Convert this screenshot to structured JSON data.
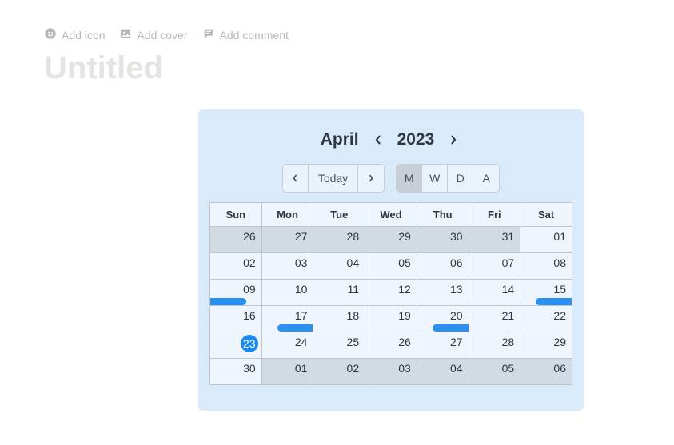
{
  "page": {
    "actions": {
      "add_icon": "Add icon",
      "add_cover": "Add cover",
      "add_comment": "Add comment"
    },
    "title": "Untitled"
  },
  "calendar": {
    "month": "April",
    "year": "2023",
    "today_label": "Today",
    "views": {
      "month": "M",
      "week": "W",
      "day": "D",
      "agenda": "A"
    },
    "active_view": "M",
    "day_headers": [
      "Sun",
      "Mon",
      "Tue",
      "Wed",
      "Thu",
      "Fri",
      "Sat"
    ],
    "weeks": [
      [
        {
          "num": "26",
          "other": true
        },
        {
          "num": "27",
          "other": true
        },
        {
          "num": "28",
          "other": true
        },
        {
          "num": "29",
          "other": true
        },
        {
          "num": "30",
          "other": true
        },
        {
          "num": "31",
          "other": true
        },
        {
          "num": "01"
        }
      ],
      [
        {
          "num": "02"
        },
        {
          "num": "03"
        },
        {
          "num": "04"
        },
        {
          "num": "05"
        },
        {
          "num": "06"
        },
        {
          "num": "07"
        },
        {
          "num": "08"
        }
      ],
      [
        {
          "num": "09",
          "event": "left"
        },
        {
          "num": "10"
        },
        {
          "num": "11"
        },
        {
          "num": "12"
        },
        {
          "num": "13"
        },
        {
          "num": "14"
        },
        {
          "num": "15",
          "event": "right"
        }
      ],
      [
        {
          "num": "16"
        },
        {
          "num": "17",
          "event": "right"
        },
        {
          "num": "18"
        },
        {
          "num": "19"
        },
        {
          "num": "20",
          "event": "right"
        },
        {
          "num": "21"
        },
        {
          "num": "22"
        }
      ],
      [
        {
          "num": "23",
          "today": true
        },
        {
          "num": "24"
        },
        {
          "num": "25"
        },
        {
          "num": "26"
        },
        {
          "num": "27"
        },
        {
          "num": "28"
        },
        {
          "num": "29"
        }
      ],
      [
        {
          "num": "30"
        },
        {
          "num": "01",
          "other": true
        },
        {
          "num": "02",
          "other": true
        },
        {
          "num": "03",
          "other": true
        },
        {
          "num": "04",
          "other": true
        },
        {
          "num": "05",
          "other": true
        },
        {
          "num": "06",
          "other": true
        }
      ]
    ]
  }
}
